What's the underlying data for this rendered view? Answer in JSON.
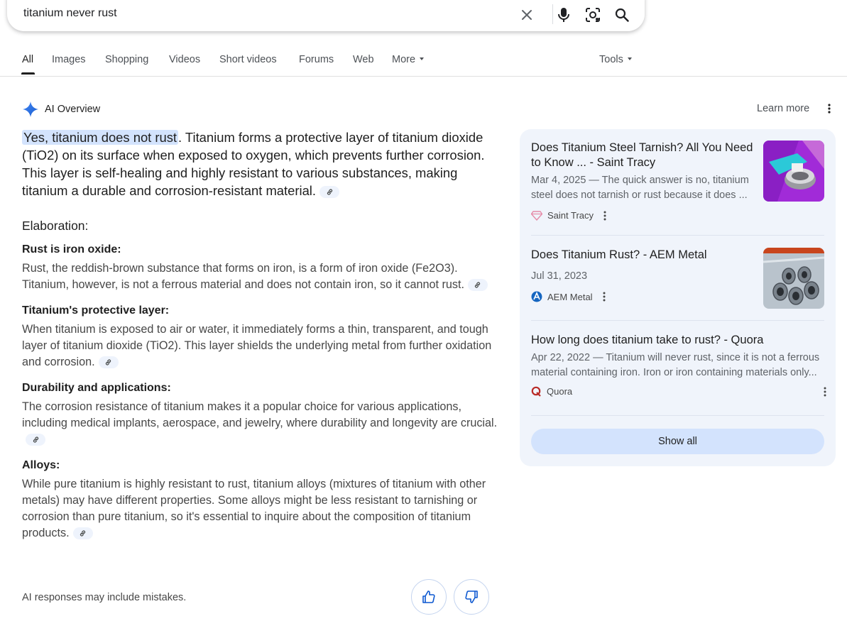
{
  "search": {
    "query": "titanium never rust"
  },
  "tabs": [
    {
      "label": "All"
    },
    {
      "label": "Images"
    },
    {
      "label": "Shopping"
    },
    {
      "label": "Videos"
    },
    {
      "label": "Short videos"
    },
    {
      "label": "Forums"
    },
    {
      "label": "Web"
    },
    {
      "label": "More"
    }
  ],
  "tools_label": "Tools",
  "ai": {
    "title": "AI Overview",
    "learn_more": "Learn more",
    "highlight": "Yes, titanium does not rust",
    "lead_rest": ". Titanium forms a protective layer of titanium dioxide (TiO2) on its surface when exposed to oxygen, which prevents further corrosion. This layer is self-healing and highly resistant to various substances, making titanium a durable and corrosion-resistant material.",
    "elaboration": "Elaboration:",
    "sections": [
      {
        "heading": "Rust is iron oxide:",
        "text": "Rust, the reddish-brown substance that forms on iron, is a form of iron oxide (Fe2O3). Titanium, however, is not a ferrous material and does not contain iron, so it cannot rust."
      },
      {
        "heading": "Titanium's protective layer:",
        "text": "When titanium is exposed to air or water, it immediately forms a thin, transparent, and tough layer of titanium dioxide (TiO2). This layer shields the underlying metal from further oxidation and corrosion."
      },
      {
        "heading": "Durability and applications:",
        "text": "The corrosion resistance of titanium makes it a popular choice for various applications, including medical implants, aerospace, and jewelry, where durability and longevity are crucial."
      },
      {
        "heading": "Alloys:",
        "text": "While pure titanium is highly resistant to rust, titanium alloys (mixtures of titanium with other metals) may have different properties. Some alloys might be less resistant to tarnishing or corrosion than pure titanium, so it's essential to inquire about the composition of titanium products."
      }
    ],
    "disclaimer": "AI responses may include mistakes."
  },
  "sources": [
    {
      "title": "Does Titanium Steel Tarnish? All You Need to Know ... - Saint Tracy",
      "snippet": "Mar 4, 2025 — The quick answer is no, titanium steel does not tarnish or rust because it does ...",
      "source": "Saint Tracy"
    },
    {
      "title": "Does Titanium Rust? - AEM Metal",
      "snippet": "Jul 31, 2023",
      "source": "AEM Metal"
    },
    {
      "title": "How long does titanium take to rust? - Quora",
      "snippet": "Apr 22, 2022 — Titanium will never rust, since it is not a ferrous material containing iron. Iron or iron containing materials only...",
      "source": "Quora"
    }
  ],
  "show_all": "Show all",
  "colors": {
    "accent": "#1a73e8",
    "highlight": "#d3e3fd",
    "panel": "#f0f4fb"
  }
}
